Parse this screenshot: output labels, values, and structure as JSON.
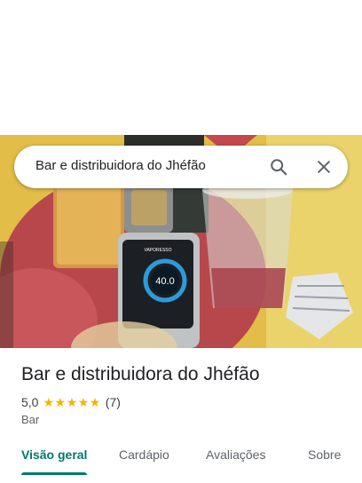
{
  "search": {
    "query": "Bar e distribuidora do Jhéfão"
  },
  "place": {
    "name": "Bar e distribuidora do Jhéfão",
    "rating": "5,0",
    "stars": 5,
    "review_count": "(7)",
    "category": "Bar"
  },
  "tabs": [
    {
      "label": "Visão geral",
      "active": true
    },
    {
      "label": "Cardápio",
      "active": false
    },
    {
      "label": "Avaliações",
      "active": false
    },
    {
      "label": "Sobre",
      "active": false
    }
  ],
  "photo_device_text": {
    "brand": "VAPORESSO",
    "reading": "40.0"
  },
  "colors": {
    "accent": "#00796b",
    "star": "#f4b400",
    "text": "#202124"
  },
  "icons": {
    "search": "search-icon",
    "close": "close-icon",
    "star": "star-icon"
  }
}
